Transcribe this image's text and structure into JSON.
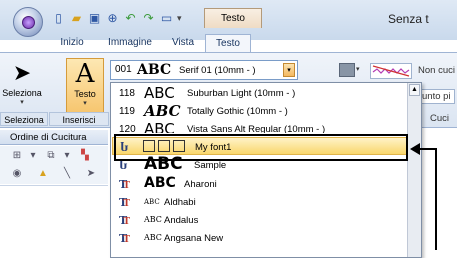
{
  "titlebar": {
    "context_tab": "Testo",
    "window_title": "Senza t",
    "qat_icons": [
      "new-icon",
      "open-icon",
      "save-icon",
      "zoom-icon",
      "undo-icon",
      "redo-icon",
      "view-icon",
      "customize-icon"
    ]
  },
  "ribbon_tabs": [
    "Inizio",
    "Immagine",
    "Vista",
    "Testo"
  ],
  "ribbon": {
    "seleziona_label": "Seleziona",
    "testo_label": "Testo",
    "group_labels": [
      "Seleziona",
      "Inserisci"
    ],
    "font_combo": {
      "number": "001",
      "sample": "ABC",
      "name": "Serif 01  (10mm - )"
    },
    "right": {
      "non_cuci": "Non cuci",
      "punto": "unto pi",
      "cuci": "Cuci"
    }
  },
  "left_panel": {
    "title": "Ordine di Cucitura"
  },
  "font_list": [
    {
      "number": "118",
      "sample": "ABC",
      "name": "Suburban Light  (10mm - )",
      "style": "builtin"
    },
    {
      "number": "119",
      "sample": "ABC",
      "name": "Totally Gothic  (10mm - )",
      "style": "builtin-gothic"
    },
    {
      "number": "120",
      "sample": "ABC",
      "name": "Vista Sans Alt Regular  (10mm - )",
      "style": "builtin-partial"
    },
    {
      "number": "",
      "sample": "",
      "name": "My font1",
      "style": "custom-highlight"
    },
    {
      "number": "",
      "sample": "ABC",
      "name": "Sample",
      "style": "custom"
    },
    {
      "number": "",
      "sample": "ABC",
      "name": "Aharoni",
      "style": "truetype-large"
    },
    {
      "number": "",
      "sample": "ABC",
      "name": "Aldhabi",
      "style": "truetype-small"
    },
    {
      "number": "",
      "sample": "ABC",
      "name": "Andalus",
      "style": "truetype-small"
    },
    {
      "number": "",
      "sample": "ABC",
      "name": "Angsana New",
      "style": "truetype-small"
    }
  ],
  "colors": {
    "highlight": "#f9d76d",
    "ribbon_bg": "#dbe5f2",
    "accent_border": "#7a9cc8"
  }
}
